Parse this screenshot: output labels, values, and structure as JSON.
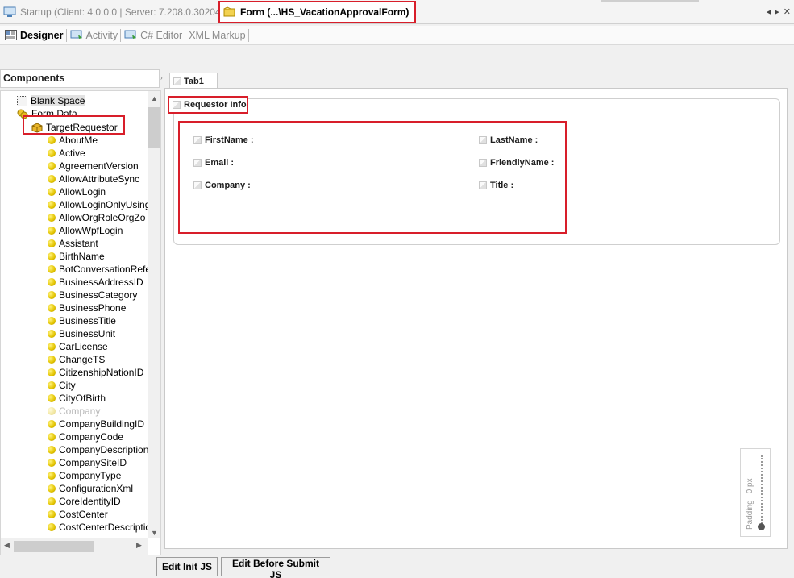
{
  "doc_tabs": {
    "startup": "Startup (Client: 4.0.0.0 | Server: 7.208.0.30204)",
    "form": "Form (...\\HS_VacationApprovalForm)"
  },
  "toolbar": {
    "designer": "Designer",
    "activity": "Activity",
    "csharp": "C# Editor",
    "xml": "XML Markup"
  },
  "components": {
    "title": "Components",
    "blank_space": "Blank Space",
    "form_data": "Form Data",
    "target": "TargetRequestor",
    "items": [
      "AboutMe",
      "Active",
      "AgreementVersion",
      "AllowAttributeSync",
      "AllowLogin",
      "AllowLoginOnlyUsing",
      "AllowOrgRoleOrgZo",
      "AllowWpfLogin",
      "Assistant",
      "BirthName",
      "BotConversationRefe",
      "BusinessAddressID",
      "BusinessCategory",
      "BusinessPhone",
      "BusinessTitle",
      "BusinessUnit",
      "CarLicense",
      "ChangeTS",
      "CitizenshipNationID",
      "City",
      "CityOfBirth",
      "Company",
      "CompanyBuildingID",
      "CompanyCode",
      "CompanyDescription",
      "CompanySiteID",
      "CompanyType",
      "ConfigurationXml",
      "CoreIdentityID",
      "CostCenter",
      "CostCenterDescriptic"
    ],
    "disabled_item": "Company"
  },
  "designer": {
    "tab": "Tab1",
    "group_title": "Requestor Info",
    "fields_left": [
      "FirstName",
      "Email",
      "Company"
    ],
    "fields_right": [
      "LastName",
      "FriendlyName",
      "Title"
    ],
    "padding_label": "Padding",
    "padding_value": "0 px"
  },
  "buttons": {
    "init": "Edit Init JS",
    "before_submit": "Edit Before Submit JS"
  }
}
